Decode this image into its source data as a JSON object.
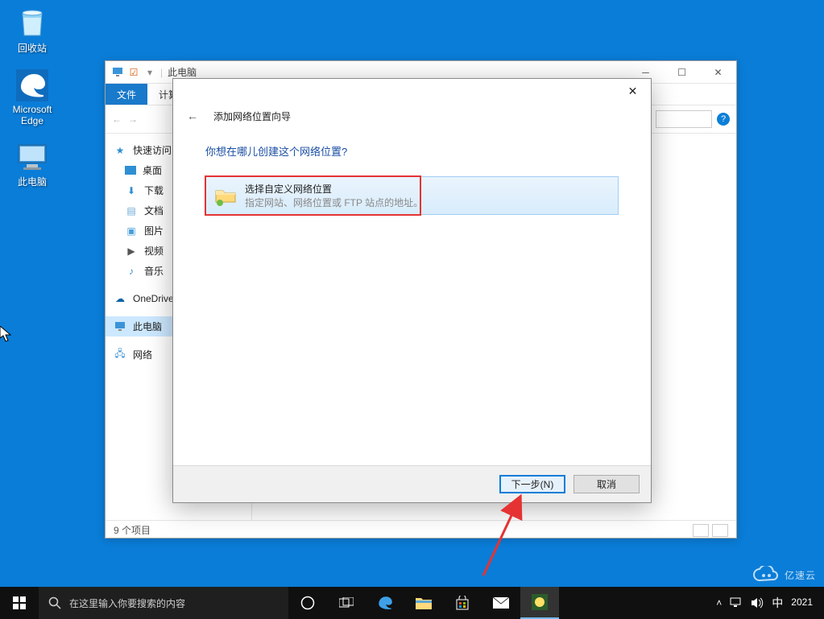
{
  "desktop": {
    "icons": [
      {
        "label": "回收站"
      },
      {
        "label": "Microsoft\nEdge"
      },
      {
        "label": "此电脑"
      }
    ]
  },
  "explorer": {
    "title": "此电脑",
    "tabs": {
      "file": "文件",
      "computer": "计算机"
    },
    "sidebar": {
      "quick_access": "快速访问",
      "desktop": "桌面",
      "downloads": "下载",
      "documents": "文档",
      "pictures": "图片",
      "videos": "视频",
      "music": "音乐",
      "onedrive": "OneDrive",
      "this_pc": "此电脑",
      "network": "网络"
    },
    "status": "9 个项目"
  },
  "wizard": {
    "title": "添加网络位置向导",
    "question": "你想在哪儿创建这个网络位置?",
    "option": {
      "title": "选择自定义网络位置",
      "desc": "指定网站、网络位置或 FTP 站点的地址。"
    },
    "next": "下一步(N)",
    "cancel": "取消"
  },
  "taskbar": {
    "search_placeholder": "在这里输入你要搜索的内容",
    "ime": "中",
    "clock_year": "2021"
  },
  "watermark": "亿速云"
}
